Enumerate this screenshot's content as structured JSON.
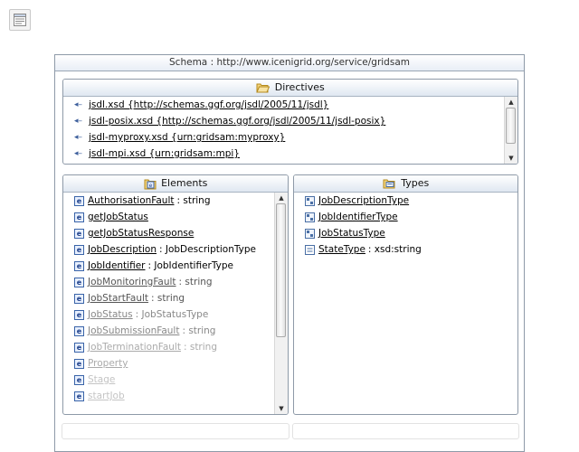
{
  "schema": {
    "title": "Schema : http://www.icenigrid.org/service/gridsam"
  },
  "directives": {
    "title": "Directives",
    "items": [
      "jsdl.xsd  {http://schemas.ggf.org/jsdl/2005/11/jsdl}",
      "jsdl-posix.xsd  {http://schemas.ggf.org/jsdl/2005/11/jsdl-posix}",
      "jsdl-myproxy.xsd  {urn:gridsam:myproxy}",
      "jsdl-mpi.xsd  {urn:gridsam:mpi}"
    ]
  },
  "elements": {
    "title": "Elements",
    "items": [
      {
        "name": "AuthorisationFault",
        "type": ": string"
      },
      {
        "name": "getJobStatus",
        "type": ""
      },
      {
        "name": "getJobStatusResponse",
        "type": ""
      },
      {
        "name": "JobDescription",
        "type": ": JobDescriptionType"
      },
      {
        "name": "JobIdentifier",
        "type": ": JobIdentifierType"
      },
      {
        "name": "JobMonitoringFault",
        "type": ": string"
      },
      {
        "name": "JobStartFault",
        "type": ": string"
      },
      {
        "name": "JobStatus",
        "type": ": JobStatusType"
      },
      {
        "name": "JobSubmissionFault",
        "type": ": string"
      },
      {
        "name": "JobTerminationFault",
        "type": ": string"
      },
      {
        "name": "Property",
        "type": ""
      },
      {
        "name": "Stage",
        "type": ""
      },
      {
        "name": "startJob",
        "type": ""
      }
    ]
  },
  "types": {
    "title": "Types",
    "items": [
      {
        "name": "JobDescriptionType",
        "type": ""
      },
      {
        "name": "JobIdentifierType",
        "type": ""
      },
      {
        "name": "JobStatusType",
        "type": ""
      },
      {
        "name": "StateType",
        "type": ": xsd:string"
      }
    ]
  },
  "colors": {
    "border": "#8e9aa8",
    "header_gradient_end": "#dfe7f1",
    "icon_blue": "#3a64a8"
  }
}
